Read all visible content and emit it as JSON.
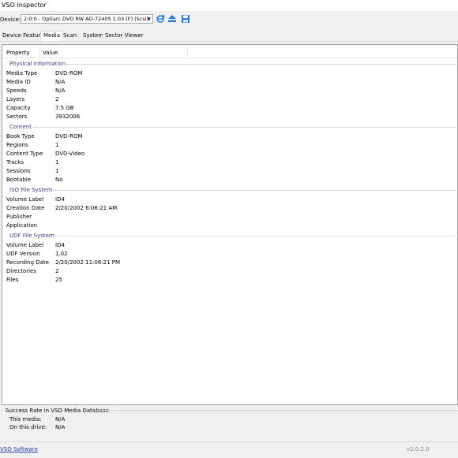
{
  "window": {
    "title": "VSO Inspector"
  },
  "device": {
    "label": "Device:",
    "selected": "2:0:0 - Optiarc DVD RW AD-7240S 1.03 [F] (Scsi)"
  },
  "icons": {
    "refresh": "refresh-icon",
    "eject": "eject-icon",
    "save": "save-icon"
  },
  "tabs": [
    {
      "label": "Device Features"
    },
    {
      "label": "Media"
    },
    {
      "label": "Scan"
    },
    {
      "label": "System"
    },
    {
      "label": "Sector Viewer"
    }
  ],
  "table": {
    "headers": {
      "property": "Property",
      "value": "Value"
    },
    "groups": [
      {
        "name": "Physical Information",
        "rows": [
          {
            "k": "Media Type",
            "v": "DVD-ROM"
          },
          {
            "k": "Media ID",
            "v": "N/A"
          },
          {
            "k": "Speeds",
            "v": "N/A"
          },
          {
            "k": "Layers",
            "v": "2"
          },
          {
            "k": "Capacity",
            "v": "7.5 GB"
          },
          {
            "k": "Sectors",
            "v": "3932006"
          }
        ]
      },
      {
        "name": "Content",
        "rows": [
          {
            "k": "Book Type",
            "v": "DVD-ROM"
          },
          {
            "k": "Regions",
            "v": "1"
          },
          {
            "k": "Content Type",
            "v": "DVD-Video"
          },
          {
            "k": "Tracks",
            "v": "1"
          },
          {
            "k": "Sessions",
            "v": "1"
          },
          {
            "k": "Bootable",
            "v": "No"
          }
        ]
      },
      {
        "name": "ISO File System",
        "rows": [
          {
            "k": "Volume Label",
            "v": "ID4"
          },
          {
            "k": "Creation Date",
            "v": "2/20/2002 6:06:21 AM"
          },
          {
            "k": "Publisher",
            "v": ""
          },
          {
            "k": "Application",
            "v": ""
          }
        ]
      },
      {
        "name": "UDF File System",
        "rows": [
          {
            "k": "Volume Label",
            "v": "ID4"
          },
          {
            "k": "UDF Version",
            "v": "1.02"
          },
          {
            "k": "Recording Date",
            "v": "2/20/2002 11:06:21 PM"
          },
          {
            "k": "Directories",
            "v": "2"
          },
          {
            "k": "Files",
            "v": "25"
          }
        ]
      }
    ]
  },
  "success": {
    "title": "Success Rate in VSO Media Database",
    "this_media_label": "This media:",
    "this_media_value": "N/A",
    "this_drive_label": "On this drive:",
    "this_drive_value": "N/A"
  },
  "footer": {
    "link": "VSO Software",
    "version": "v2.0.2.0"
  },
  "colors": {
    "group_header": "#3b3b8a",
    "link": "#1f3fa8",
    "accent_icon": "#2a7bd1"
  }
}
